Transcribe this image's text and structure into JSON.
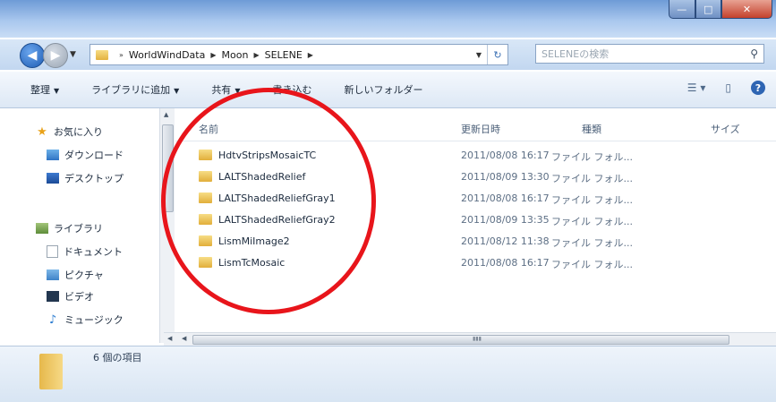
{
  "window": {
    "minimize_icon": "minimize-icon",
    "maximize_icon": "maximize-icon",
    "close_icon": "close-icon",
    "minimize_glyph": "—",
    "maximize_glyph": "□",
    "close_glyph": "✕"
  },
  "address": {
    "breadcrumb": [
      "WorldWindData",
      "Moon",
      "SELENE"
    ],
    "search_placeholder": "SELENEの検索"
  },
  "toolbar": {
    "organize": "整理",
    "add_library": "ライブラリに追加",
    "share": "共有",
    "burn": "書き込む",
    "new_folder": "新しいフォルダー"
  },
  "nav": {
    "favorites": "お気に入り",
    "downloads": "ダウンロード",
    "desktop": "デスクトップ",
    "libraries": "ライブラリ",
    "documents": "ドキュメント",
    "pictures": "ピクチャ",
    "videos": "ビデオ",
    "music": "ミュージック"
  },
  "columns": {
    "name": "名前",
    "date": "更新日時",
    "type": "種類",
    "size": "サイズ"
  },
  "files": [
    {
      "name": "HdtvStripsMosaicTC",
      "date": "2011/08/08 16:17",
      "type": "ファイル フォル..."
    },
    {
      "name": "LALTShadedRelief",
      "date": "2011/08/09 13:30",
      "type": "ファイル フォル..."
    },
    {
      "name": "LALTShadedReliefGray1",
      "date": "2011/08/08 16:17",
      "type": "ファイル フォル..."
    },
    {
      "name": "LALTShadedReliefGray2",
      "date": "2011/08/09 13:35",
      "type": "ファイル フォル..."
    },
    {
      "name": "LismMiImage2",
      "date": "2011/08/12 11:38",
      "type": "ファイル フォル..."
    },
    {
      "name": "LismTcMosaic",
      "date": "2011/08/08 16:17",
      "type": "ファイル フォル..."
    }
  ],
  "status": {
    "item_count": "6 個の項目"
  },
  "colors": {
    "annotation": "#e8151b",
    "folder": "#e8b84b"
  }
}
